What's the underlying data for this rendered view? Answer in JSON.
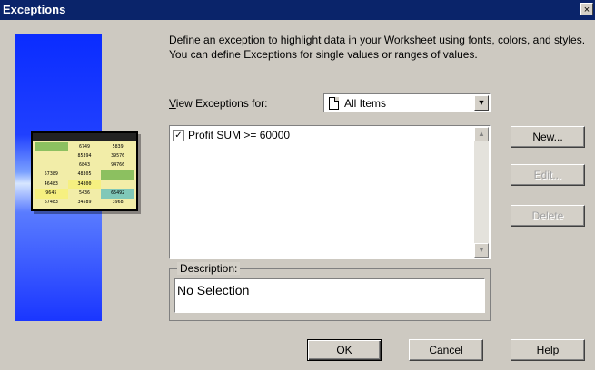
{
  "window": {
    "title": "Exceptions",
    "close_label": "×"
  },
  "intro_text": "Define an exception to highlight data in your Worksheet using fonts, colors, and styles. You can define Exceptions for single values or ranges of values.",
  "view_exceptions": {
    "label_prefix": "V",
    "label_rest": "iew Exceptions for:",
    "selected_value": "All Items",
    "dropdown_arrow": "▼"
  },
  "exceptions_list": {
    "items": [
      {
        "checked": "✓",
        "label": "Profit SUM  >= 60000"
      }
    ],
    "scroll_up": "▲",
    "scroll_down": "▼"
  },
  "description": {
    "legend": "Description:",
    "value": "No Selection"
  },
  "buttons": {
    "new_label": "New...",
    "edit_label": "Edit...",
    "delete_label": "Delete",
    "ok_label": "OK",
    "cancel_label": "Cancel",
    "help_label": "Help"
  },
  "illustration": {
    "cells": [
      "",
      "6749",
      "5839",
      "",
      "85394",
      "39576",
      "",
      "6843",
      "94766",
      "57389",
      "48305",
      "",
      "46483",
      "34800",
      "",
      "9645",
      "5436",
      "65492",
      "67483",
      "34589",
      "3968"
    ]
  }
}
